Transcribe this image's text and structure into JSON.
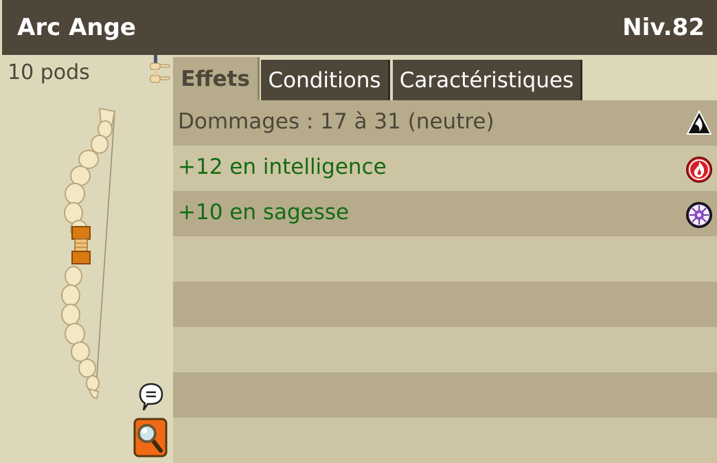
{
  "header": {
    "item_name": "Arc Ange",
    "level": "Niv.82"
  },
  "item": {
    "weight": "10 pods"
  },
  "tabs": [
    {
      "label": "Effets",
      "active": true
    },
    {
      "label": "Conditions",
      "active": false
    },
    {
      "label": "Caractéristiques",
      "active": false
    }
  ],
  "effects": [
    {
      "text": "Dommages : 17 à 31 (neutre)",
      "color": "#4f463a",
      "icon": "neutral-element-icon"
    },
    {
      "text": "+12 en intelligence",
      "color": "#146b12",
      "icon": "fire-element-icon"
    },
    {
      "text": "+10 en sagesse",
      "color": "#146b12",
      "icon": "wisdom-icon"
    }
  ],
  "colors": {
    "title_bar": "#4f463a",
    "panel": "#ddd8ba",
    "row_dark": "#b6ac8c",
    "row_light": "#cdc4a3",
    "bonus_green": "#146b12",
    "zoom_orange": "#f06a14"
  },
  "icons": {
    "hand": "two-hands-icon",
    "chat": "speech-bubble-icon",
    "zoom": "magnifier-icon"
  }
}
